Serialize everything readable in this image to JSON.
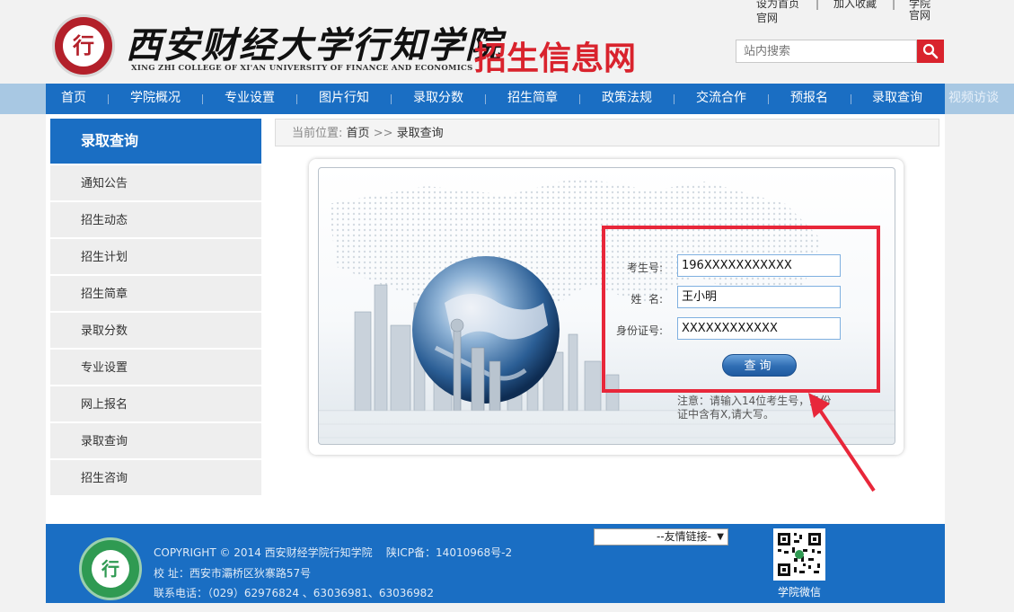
{
  "top_links": [
    "设为首页",
    "加入收藏",
    "学院官网"
  ],
  "header": {
    "emblem_text": "行",
    "college_cn": "西安财经大学行知学院",
    "college_en": "XING ZHI COLLEGE OF XI'AN UNIVERSITY OF FINANCE AND ECONOMICS",
    "site_title": "招生信息网"
  },
  "search": {
    "placeholder": "站内搜索",
    "icon": "search-icon"
  },
  "nav": {
    "items": [
      "首页",
      "学院概况",
      "专业设置",
      "图片行知",
      "录取分数",
      "招生简章",
      "政策法规",
      "交流合作",
      "预报名",
      "录取查询"
    ],
    "overflow_item": "视频访谈"
  },
  "sidebar": {
    "title": "录取查询",
    "items": [
      "通知公告",
      "招生动态",
      "招生计划",
      "招生简章",
      "录取分数",
      "专业设置",
      "网上报名",
      "录取查询",
      "招生咨询"
    ]
  },
  "breadcrumb": {
    "label": "当前位置:",
    "home": "首页",
    "separator": ">>",
    "current": "录取查询"
  },
  "form": {
    "exam_no_label": "考生号:",
    "exam_no_value": "196XXXXXXXXXXX",
    "name_label": "姓  名:",
    "name_value": "王小明",
    "id_label": "身份证号:",
    "id_value": "XXXXXXXXXXXX",
    "submit_label": "查询",
    "note": "注意：请输入14位考生号，身份证中含有X,请大写。"
  },
  "annotation": {
    "color": "#e8273a"
  },
  "footer": {
    "copyright": "COPYRIGHT © 2014 西安财经学院行知学院    陕ICP备：14010968号-2",
    "address": "校 址：西安市灞桥区狄寨路57号",
    "phone": "联系电话：（029）62976824 、63036981、63036982",
    "friend_links": "--友情链接-",
    "qr_caption": "学院微信",
    "logo_text": "行"
  },
  "colors": {
    "brand_blue": "#1a6ec3",
    "brand_red": "#d9232d"
  }
}
